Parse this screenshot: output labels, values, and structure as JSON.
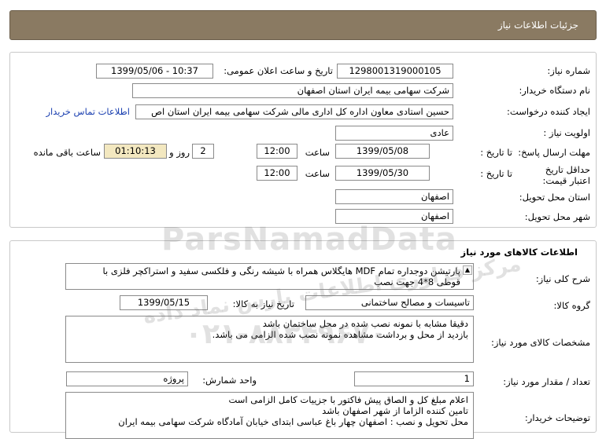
{
  "header": {
    "title": "جزئیات اطلاعات نیاز"
  },
  "need": {
    "number_label": "شماره نیاز:",
    "number": "1298001319000105",
    "announce_label": "تاریخ و ساعت اعلان عمومی:",
    "announce": "1399/05/06 - 10:37",
    "buyer_label": "نام دستگاه خریدار:",
    "buyer": "شرکت سهامی بیمه ایران استان اصفهان",
    "creator_label": "ایجاد کننده درخواست:",
    "creator": "حسین استادی معاون اداره کل اداری مالی شرکت سهامی بیمه ایران استان اص",
    "contact_link": "اطلاعات تماس خریدار",
    "priority_label": "اولویت نیاز :",
    "priority": "عادی",
    "deadline_label": "مهلت ارسال پاسخ:",
    "to_date_label": "تا تاریخ :",
    "deadline_date": "1399/05/08",
    "time_label": "ساعت",
    "deadline_time": "12:00",
    "days": "2",
    "days_label": "روز و",
    "remaining": "01:10:13",
    "remaining_label": "ساعت باقی مانده",
    "validity_label": "حداقل تاریخ اعتبار قیمت:",
    "validity_date": "1399/05/30",
    "validity_time": "12:00",
    "province_label": "استان محل تحویل:",
    "province": "اصفهان",
    "city_label": "شهر محل تحویل:",
    "city": "اصفهان"
  },
  "goods": {
    "section_title": "اطلاعات کالاهای مورد نیاز",
    "desc_label": "شرح کلی نیاز:",
    "desc_line1": "پارتیشن دوجداره تمام MDF  هایگلاس همراه با شیشه رنگی و فلکسی سفید و استراکچر فلزی با",
    "desc_line2": "قوطی 8*4 جهت نصب",
    "group_label": "گروه کالا:",
    "group": "تاسیسات و مصالح ساختمانی",
    "need_date_label": "تاریخ نیاز به کالا:",
    "need_date": "1399/05/15",
    "spec_label": "مشخصات کالای مورد نیاز:",
    "spec_line1": "دقیقا مشابه با نمونه نصب شده در محل ساختمان باشد",
    "spec_line2": "بازدید از محل و برداشت  مشاهده نمونه نصب شده الزامی می باشد.",
    "qty_label": "تعداد / مقدار مورد نیاز:",
    "qty": "1",
    "unit_label": "واحد شمارش:",
    "unit": "پروژه",
    "buyer_notes_label": "توضیحات خریدار:",
    "notes_line1": "اعلام مبلغ کل و الصاق پیش فاکتور با جزییات کامل الزامی است",
    "notes_line2": "تامین کننده الزاما از شهر اصفهان باشد",
    "notes_line3": "محل تحویل و نصب : اصفهان چهار باغ عباسی ابتدای خیابان آمادگاه شرکت سهامی بیمه ایران"
  },
  "watermark": {
    "brand": "ParsNamadData",
    "persian": "مرکز فراوری اطلاعات پارس نماد داده",
    "phone": "۰۲۱-۸۸۳۴۹۶۷۰"
  }
}
